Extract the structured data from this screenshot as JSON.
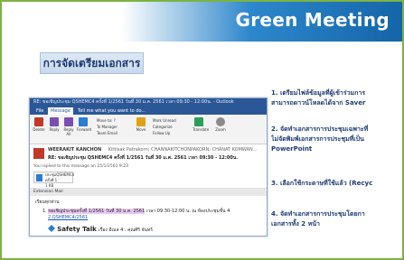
{
  "slide": {
    "title": "Green Meeting",
    "section_label": "การจัดเตรียมเอกสาร",
    "steps": [
      {
        "line1": "1. เตรียมไฟล์ข้อมูลที่ผู้เข้าร่วมการ",
        "line2": "สามารถดาวน์โหลดได้จาก Saver"
      },
      {
        "line1": "2. จัดทำเอกสารการประชุมเฉพาะที่",
        "line2": "ไม่จัดพิมพ์เอกสารการประชุมที่เป็น",
        "line3": "PowerPoint"
      },
      {
        "line1": "3. เลือกใช้กระดาษที่ใช้แล้ว (Recyc"
      },
      {
        "line1": "4. จัดทำเอกสารการประชุมโดยกา",
        "line2": "เอกสารทั้ง 2 หน้า"
      }
    ]
  },
  "outlook": {
    "window_title": "RE: ขอเชิญประชุม QSHEMC4 ครั้งที่ 1/2561 วันที่ 30 ม.ค. 2561 เวลา 09:30 - 12:00น.  -  Outlook",
    "tabs": [
      "File",
      "Message",
      "Tell me what you want to do..."
    ],
    "ribbon": {
      "delete": "Delete",
      "reply": "Reply",
      "reply_all": "Reply All",
      "forward": "Forward",
      "move_to": "Move to: ?",
      "to_manager": "To Manager",
      "team_email": "Team Email",
      "move": "Move",
      "mark_unread": "Mark Unread",
      "categorize": "Categorize",
      "follow_up": "Follow Up",
      "translate": "Translate",
      "zoom": "Zoom"
    },
    "sender": "WEERAKIT KANCHON",
    "recipients": "Kittisak Patrakorn; CHANNAKITCHONPAKORN; CHANAT KOMWAN...",
    "subject": "RE: ขอเชิญประชุม QSHEMC4 ครั้งที่ 1/2561 วันที่ 30 ม.ค. 2561 เวลา 09:30 - 12:00น.",
    "replied_note": "You replied to this message on 25/1/2561 9:23",
    "attachment_name": "ประชุมQSHEMC4 ครั้งที่ 1",
    "attachment_size": "1 KB",
    "addin_bar": "Extension Mail",
    "greeting": "เรียนทุกท่าน",
    "body_line1_prefix": "1.",
    "body_line1_highlight": "ขอเชิญประชุมครั้งที่ 1/2561 วันที่ 30 ม.ค. 2561",
    "body_line1_rest": "เวลา 09:30-12:00 น. ณ ห้องประชุมชั้น 4",
    "body_link": "2.QSHEMC4/2561",
    "safety_label": "Safety Talk",
    "safety_detail": "เรื่อง อีเมล 4 : คุณศิริ จันทร์"
  },
  "colors": {
    "header_blue": "#1565a8",
    "frame_green": "#7cb342",
    "text_blue": "#1f3b73",
    "outlook_blue": "#2b5797"
  }
}
